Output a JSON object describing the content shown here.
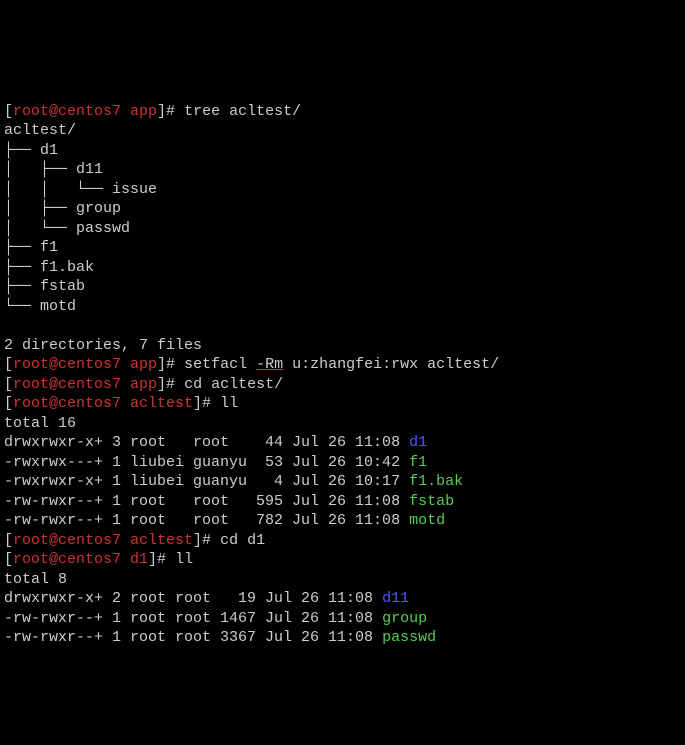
{
  "header": {
    "prompt1_open": "[",
    "prompt1_user": "root@centos7 app",
    "prompt1_close": "]# ",
    "cmd1": "tree acltest/"
  },
  "tree": {
    "l1": "acltest/",
    "l2": "├── d1",
    "l3": "│   ├── d11",
    "l4": "│   │   └── issue",
    "l5": "│   ├── group",
    "l6": "│   └── passwd",
    "l7": "├── f1",
    "l8": "├── f1.bak",
    "l9": "├── fstab",
    "l10": "└── motd",
    "blank": "",
    "summary": "2 directories, 7 files"
  },
  "cmd_setfacl": {
    "pre": "setfacl ",
    "opt": "-Rm",
    "post": " u:zhangfei:rwx acltest/"
  },
  "cmd_cd1": "cd acltest/",
  "prompt_acltest": "root@centos7 acltest",
  "cmd_ll": "ll",
  "ll1": {
    "total": "total 16",
    "r1_left": "drwxrwxr-x+ 3 root   root    44 Jul 26 11:08 ",
    "r1_name": "d1",
    "r2_left": "-rwxrwx---+ 1 liubei guanyu  53 Jul 26 10:42 ",
    "r2_name": "f1",
    "r3_left": "-rwxrwxr-x+ 1 liubei guanyu   4 Jul 26 10:17 ",
    "r3_name": "f1.bak",
    "r4_left": "-rw-rwxr--+ 1 root   root   595 Jul 26 11:08 ",
    "r4_name": "fstab",
    "r5_left": "-rw-rwxr--+ 1 root   root   782 Jul 26 11:08 ",
    "r5_name": "motd"
  },
  "cmd_cd_d1": "cd d1",
  "prompt_d1": "root@centos7 d1",
  "ll2": {
    "total": "total 8",
    "r1_left": "drwxrwxr-x+ 2 root root   19 Jul 26 11:08 ",
    "r1_name": "d11",
    "r2_left": "-rw-rwxr--+ 1 root root 1467 Jul 26 11:08 ",
    "r2_name": "group",
    "r3_left": "-rw-rwxr--+ 1 root root 3367 Jul 26 11:08 ",
    "r3_name": "passwd"
  }
}
